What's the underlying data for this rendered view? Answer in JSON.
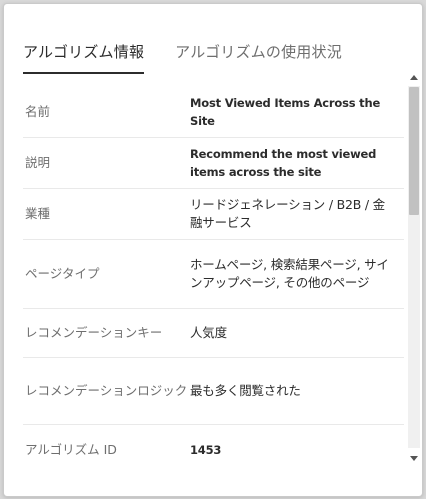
{
  "tabs": [
    {
      "label": "アルゴリズム情報",
      "active": true
    },
    {
      "label": "アルゴリズムの使用状況",
      "active": false
    }
  ],
  "details": {
    "name": {
      "label": "名前",
      "value": "Most Viewed Items Across the Site"
    },
    "description": {
      "label": "説明",
      "value": "Recommend the most viewed items across the site"
    },
    "industry": {
      "label": "業種",
      "value": "リードジェネレーション / B2B / 金融サービス"
    },
    "page_type": {
      "label": "ページタイプ",
      "value": "ホームページ, 検索結果ページ, サインアップページ, その他のページ"
    },
    "recommendation_key": {
      "label": "レコメンデーションキー",
      "value": "人気度"
    },
    "recommendation_logic": {
      "label": "レコメンデーションロジック",
      "value": "最も多く閲覧された"
    },
    "algorithm_id": {
      "label": "アルゴリズム ID",
      "value": "1453"
    }
  },
  "colors": {
    "active_tab": "#2c2c2c",
    "inactive_text": "#6e6e6e",
    "divider": "#e9e9e9"
  }
}
